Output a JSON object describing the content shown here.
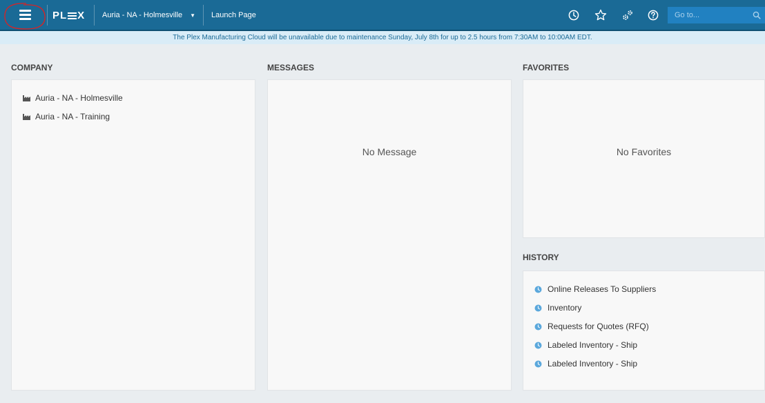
{
  "header": {
    "logo_text_left": "PL",
    "logo_text_right": "X",
    "company_selector": "Auria - NA - Holmesville",
    "launch_page": "Launch Page",
    "search_placeholder": "Go to..."
  },
  "banner": {
    "text": "The Plex Manufacturing Cloud will be unavailable due to maintenance Sunday, July 8th for up to 2.5 hours from 7:30AM to 10:00AM EDT."
  },
  "company": {
    "title": "COMPANY",
    "items": [
      "Auria - NA - Holmesville",
      "Auria - NA - Training"
    ]
  },
  "messages": {
    "title": "MESSAGES",
    "empty_text": "No Message"
  },
  "favorites": {
    "title": "FAVORITES",
    "empty_text": "No Favorites"
  },
  "history": {
    "title": "HISTORY",
    "items": [
      "Online Releases To Suppliers",
      "Inventory",
      "Requests for Quotes (RFQ)",
      "Labeled Inventory - Ship",
      "Labeled Inventory - Ship"
    ]
  },
  "icons": {
    "menu": "hamburger-menu-icon",
    "caret": "caret-down-icon",
    "recent": "clock-icon",
    "favorites": "star-icon",
    "settings": "gears-icon",
    "help": "help-icon",
    "search": "search-icon",
    "company_item": "factory-icon",
    "history_item": "history-dot-icon"
  },
  "colors": {
    "header_bg": "#1a6a96",
    "banner_bg": "#d9ecf7",
    "banner_text": "#1a6a96",
    "page_bg": "#e9edf0",
    "panel_bg": "#f8f8f8",
    "history_dot": "#5ba8dc",
    "annotation_circle": "#e02020"
  }
}
